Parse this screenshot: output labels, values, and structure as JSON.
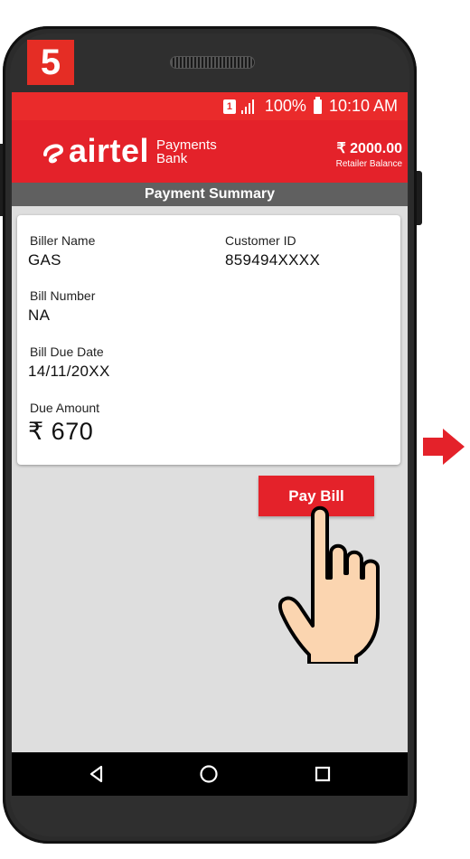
{
  "step": {
    "number": "5"
  },
  "statusbar": {
    "battery": "100%",
    "time": "10:10 AM",
    "sim": "1"
  },
  "header": {
    "brand": "airtel",
    "brand_sub_line1": "Payments",
    "brand_sub_line2": "Bank",
    "balance": "₹ 2000.00",
    "balance_label": "Retailer Balance"
  },
  "title_bar": {
    "title": "Payment Summary"
  },
  "summary": {
    "biller_name_label": "Biller Name",
    "biller_name": "GAS",
    "customer_id_label": "Customer ID",
    "customer_id": "859494XXXX",
    "bill_number_label": "Bill Number",
    "bill_number": "NA",
    "due_date_label": "Bill Due Date",
    "due_date": "14/11/20XX",
    "due_amount_label": "Due Amount",
    "due_amount": "₹ 670"
  },
  "actions": {
    "pay_bill": "Pay Bill"
  },
  "colors": {
    "brand_red": "#e4222a",
    "status_red": "#ea2b2b",
    "summary_gray": "#606060"
  },
  "icons": [
    "sim-icon",
    "signal-icon",
    "battery-icon",
    "airtel-logo-icon",
    "hand-pointer-icon",
    "back-icon",
    "home-icon",
    "recents-icon",
    "next-arrow-icon"
  ]
}
